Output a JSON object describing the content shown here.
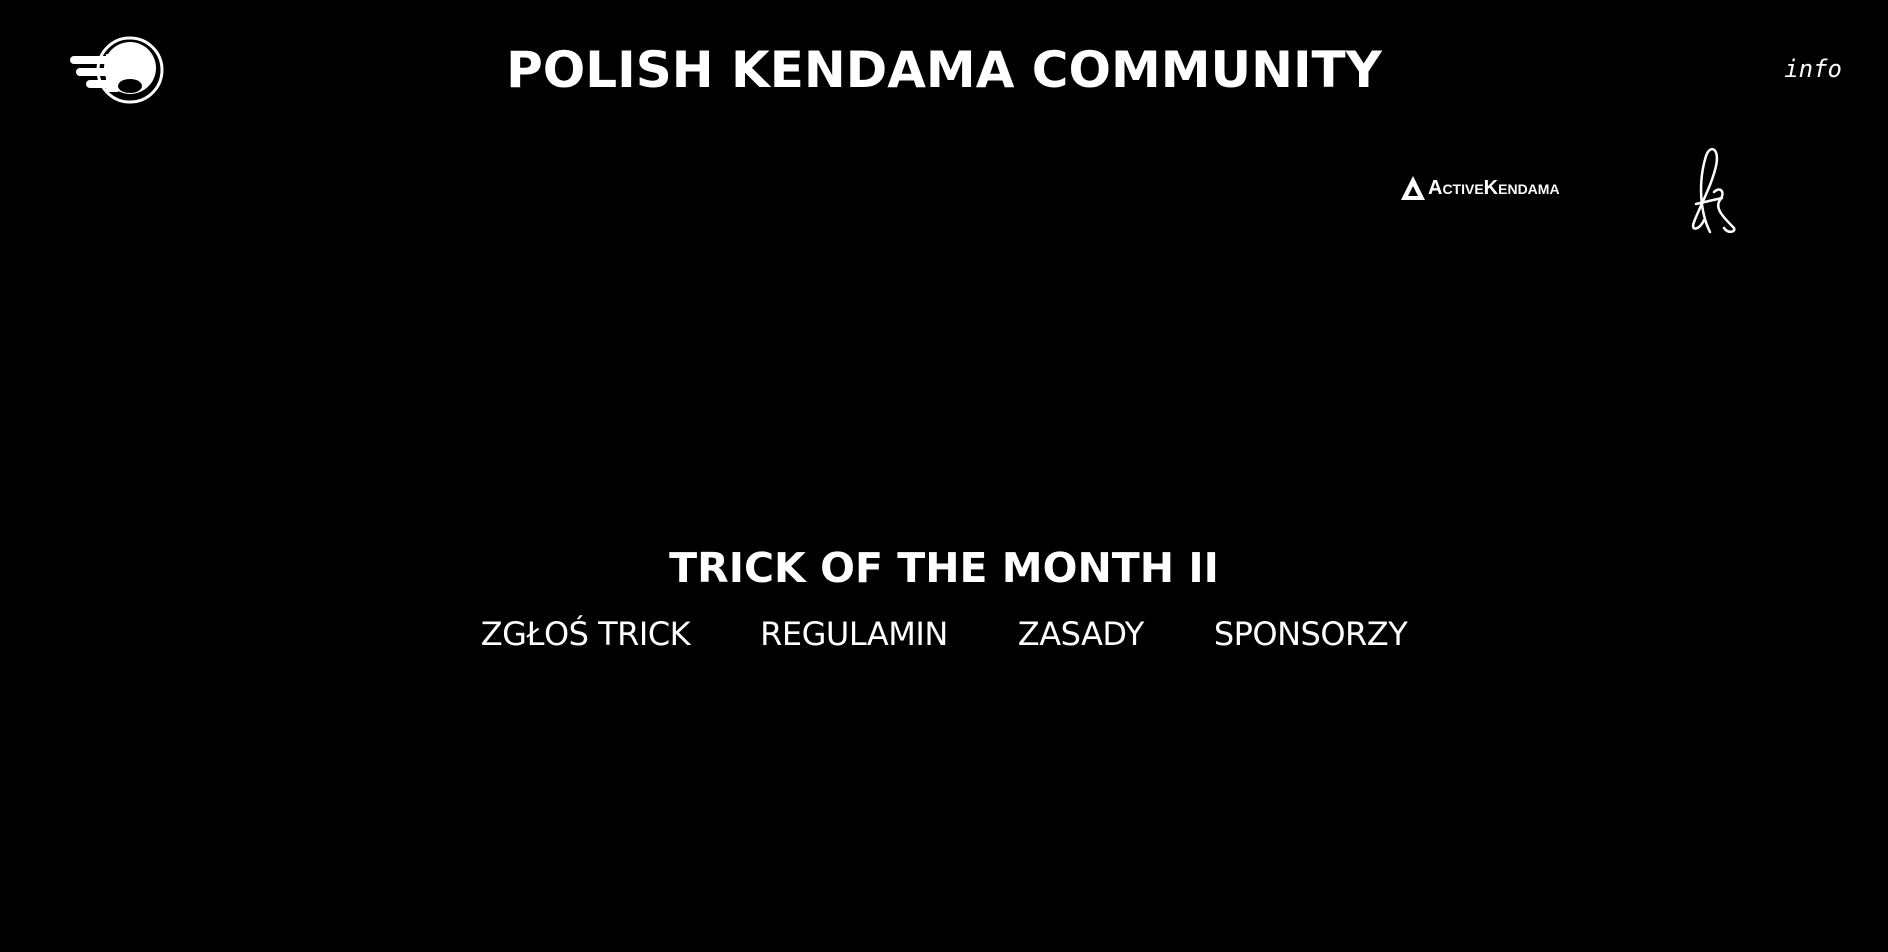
{
  "header": {
    "logo_icon": "kendama-ball-logo",
    "title": "POLISH KENDAMA COMMUNITY",
    "info_link": "info"
  },
  "sponsors": {
    "active_kendama": "ActiveKendama",
    "signature_logo_icon": "signature-logo"
  },
  "main": {
    "section_title": "TRICK OF THE MONTH II",
    "nav": [
      {
        "label": "ZGŁOŚ TRICK"
      },
      {
        "label": "REGULAMIN"
      },
      {
        "label": "ZASADY"
      },
      {
        "label": "SPONSORZY"
      }
    ]
  },
  "colors": {
    "background": "#000000",
    "foreground": "#ffffff"
  }
}
